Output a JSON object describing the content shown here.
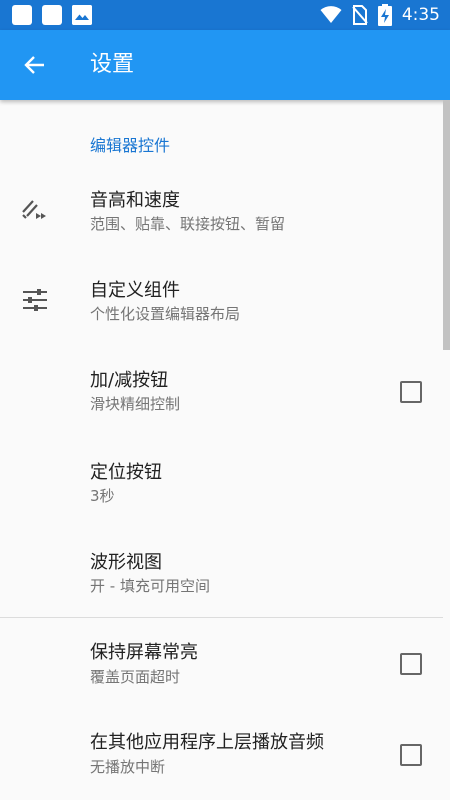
{
  "status_bar": {
    "time": "4:35",
    "icons": [
      "notification-square-icon",
      "notification-square-icon",
      "image-icon",
      "wifi-icon",
      "no-sim-icon",
      "battery-charging-icon"
    ]
  },
  "app_bar": {
    "back_icon": "arrow-left-icon",
    "title": "设置"
  },
  "section": {
    "header": "编辑器控件"
  },
  "items": [
    {
      "title": "音高和速度",
      "subtitle": "范围、贴靠、联接按钮、暂留",
      "icon": "pitch-speed-icon",
      "checkbox": false
    },
    {
      "title": "自定义组件",
      "subtitle": "个性化设置编辑器布局",
      "icon": "sliders-icon",
      "checkbox": false
    },
    {
      "title": "加/减按钮",
      "subtitle": "滑块精细控制",
      "checkbox": true,
      "checked": false
    },
    {
      "title": "定位按钮",
      "subtitle": "3秒",
      "checkbox": false
    },
    {
      "title": "波形视图",
      "subtitle": "开 - 填充可用空间",
      "checkbox": false
    },
    {
      "title": "保持屏幕常亮",
      "subtitle": "覆盖页面超时",
      "checkbox": true,
      "checked": false
    },
    {
      "title": "在其他应用程序上层播放音频",
      "subtitle": "无播放中断",
      "checkbox": true,
      "checked": false
    }
  ],
  "colors": {
    "status_bar": "#1976d2",
    "app_bar": "#2196f3",
    "accent": "#1976d2",
    "background": "#fafafa"
  }
}
